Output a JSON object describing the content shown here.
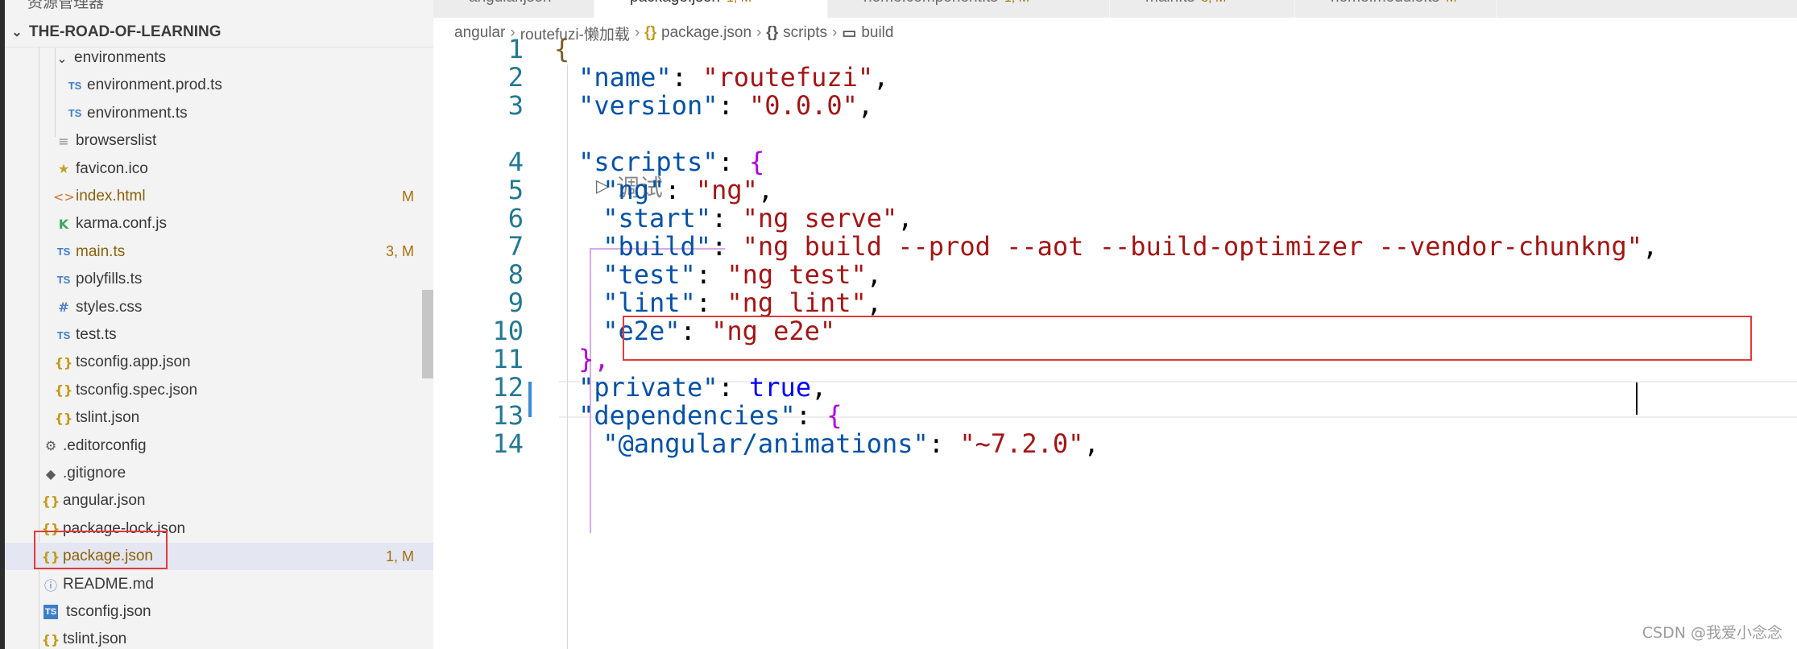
{
  "sidebar": {
    "title": "资源管理器",
    "project": "THE-ROAD-OF-LEARNING",
    "items": [
      {
        "label": "environments",
        "icon": "chevron-down-icon",
        "glyph": "⌄",
        "badge": ""
      },
      {
        "label": "environment.prod.ts",
        "icon": "typescript-icon",
        "glyph": "TS",
        "badge": ""
      },
      {
        "label": "environment.ts",
        "icon": "typescript-icon",
        "glyph": "TS",
        "badge": ""
      },
      {
        "label": "browserslist",
        "icon": "lines-icon",
        "glyph": "≡",
        "badge": ""
      },
      {
        "label": "favicon.ico",
        "icon": "star-icon",
        "glyph": "★",
        "badge": ""
      },
      {
        "label": "index.html",
        "icon": "html-icon",
        "glyph": "<>",
        "badge": "M"
      },
      {
        "label": "karma.conf.js",
        "icon": "karma-icon",
        "glyph": "K",
        "badge": ""
      },
      {
        "label": "main.ts",
        "icon": "typescript-icon",
        "glyph": "TS",
        "badge": "3, M"
      },
      {
        "label": "polyfills.ts",
        "icon": "typescript-icon",
        "glyph": "TS",
        "badge": ""
      },
      {
        "label": "styles.css",
        "icon": "css-hash-icon",
        "glyph": "#",
        "badge": ""
      },
      {
        "label": "test.ts",
        "icon": "typescript-icon",
        "glyph": "TS",
        "badge": ""
      },
      {
        "label": "tsconfig.app.json",
        "icon": "json-braces-icon",
        "glyph": "{}",
        "badge": ""
      },
      {
        "label": "tsconfig.spec.json",
        "icon": "json-braces-icon",
        "glyph": "{}",
        "badge": ""
      },
      {
        "label": "tslint.json",
        "icon": "json-braces-icon",
        "glyph": "{}",
        "badge": ""
      },
      {
        "label": ".editorconfig",
        "icon": "gear-icon",
        "glyph": "⚙",
        "badge": ""
      },
      {
        "label": ".gitignore",
        "icon": "git-diamond-icon",
        "glyph": "◆",
        "badge": ""
      },
      {
        "label": "angular.json",
        "icon": "json-braces-icon",
        "glyph": "{}",
        "badge": ""
      },
      {
        "label": "package-lock.json",
        "icon": "json-braces-icon",
        "glyph": "{}",
        "badge": ""
      },
      {
        "label": "package.json",
        "icon": "json-braces-icon",
        "glyph": "{}",
        "badge": "1, M"
      },
      {
        "label": "README.md",
        "icon": "info-icon",
        "glyph": "ⓘ",
        "badge": ""
      },
      {
        "label": "tsconfig.json",
        "icon": "ts-box-icon",
        "glyph": "TS",
        "badge": ""
      },
      {
        "label": "tslint.json",
        "icon": "json-braces-icon",
        "glyph": "{}",
        "badge": ""
      }
    ]
  },
  "tabs": [
    {
      "label": "angular.json",
      "suffix": "",
      "close": ""
    },
    {
      "label": "package.json",
      "suffix": "1, M",
      "close": "×"
    },
    {
      "label": "home.component.ts",
      "suffix": "1, M",
      "close": ""
    },
    {
      "label": "main.ts",
      "suffix": "3, M",
      "close": ""
    },
    {
      "label": "home.module.ts",
      "suffix": "M",
      "close": ""
    }
  ],
  "breadcrumb": {
    "parts": [
      "angular",
      "routefuzi-懒加载",
      "package.json",
      "scripts",
      "build"
    ],
    "icons": [
      "{}",
      "{}",
      "▭"
    ]
  },
  "editor": {
    "codelens": "调试",
    "line_numbers": [
      "1",
      "2",
      "3",
      "4",
      "5",
      "6",
      "7",
      "8",
      "9",
      "10",
      "11",
      "12",
      "13",
      "14"
    ],
    "lines": [
      {
        "key": "",
        "val": "",
        "raw": "{"
      },
      {
        "key": "\"name\"",
        "val": "\"routefuzi\"",
        "tail": ","
      },
      {
        "key": "\"version\"",
        "val": "\"0.0.0\"",
        "tail": ","
      },
      {
        "key": "\"scripts\"",
        "val": "{",
        "tail": ""
      },
      {
        "key": "\"ng\"",
        "val": "\"ng\"",
        "tail": ","
      },
      {
        "key": "\"start\"",
        "val": "\"ng serve\"",
        "tail": ","
      },
      {
        "key": "\"build\"",
        "val": "\"ng build --prod --aot --build-optimizer --vendor-chunkng\"",
        "tail": ","
      },
      {
        "key": "\"test\"",
        "val": "\"ng test\"",
        "tail": ","
      },
      {
        "key": "\"lint\"",
        "val": "\"ng lint\"",
        "tail": ","
      },
      {
        "key": "\"e2e\"",
        "val": "\"ng e2e\"",
        "tail": ""
      },
      {
        "key": "",
        "val": "",
        "raw": "},"
      },
      {
        "key": "\"private\"",
        "val": "true",
        "tail": ","
      },
      {
        "key": "\"dependencies\"",
        "val": "{",
        "tail": ""
      },
      {
        "key": "\"@angular/animations\"",
        "val": "\"~7.2.0\"",
        "tail": ","
      }
    ]
  },
  "watermark": "CSDN @我爱小念念",
  "colors": {
    "accent": "#3c8ad6",
    "highlight_box": "#e03a3a",
    "json_key": "#0451a5",
    "json_string": "#a31515",
    "keyword": "#0000ff",
    "line_number": "#237893",
    "modified_badge": "#a56f0c"
  }
}
